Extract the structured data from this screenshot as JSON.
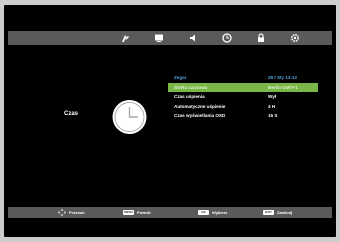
{
  "tabs": [
    {
      "name": "picture-settings-icon"
    },
    {
      "name": "display-icon"
    },
    {
      "name": "sound-icon"
    },
    {
      "name": "clock-icon"
    },
    {
      "name": "lock-icon"
    },
    {
      "name": "gear-icon"
    }
  ],
  "section_label": "Czas",
  "menu": {
    "header": {
      "label": "Zegar",
      "value": "28 / Sty 13:12"
    },
    "rows": [
      {
        "label": "Strefa czasowa",
        "value": "Berlin GMT+1"
      },
      {
        "label": "Czas uśpienia",
        "value": "Wył"
      },
      {
        "label": "Automatyczne uśpienie",
        "value": "4 H"
      },
      {
        "label": "Czas wyświetlania OSD",
        "value": "15 S"
      }
    ]
  },
  "footer": {
    "move": {
      "label": "Przesuń"
    },
    "back": {
      "key": "MENU",
      "label": "Powrót"
    },
    "select": {
      "key": "OK",
      "label": "Wybierz"
    },
    "close": {
      "key": "EXIT",
      "label": "Zamknij"
    }
  },
  "colors": {
    "background": "#000000",
    "bar": "#5a5a5a",
    "header_text": "#4fa3d8",
    "selected_row": "#7ab648"
  }
}
